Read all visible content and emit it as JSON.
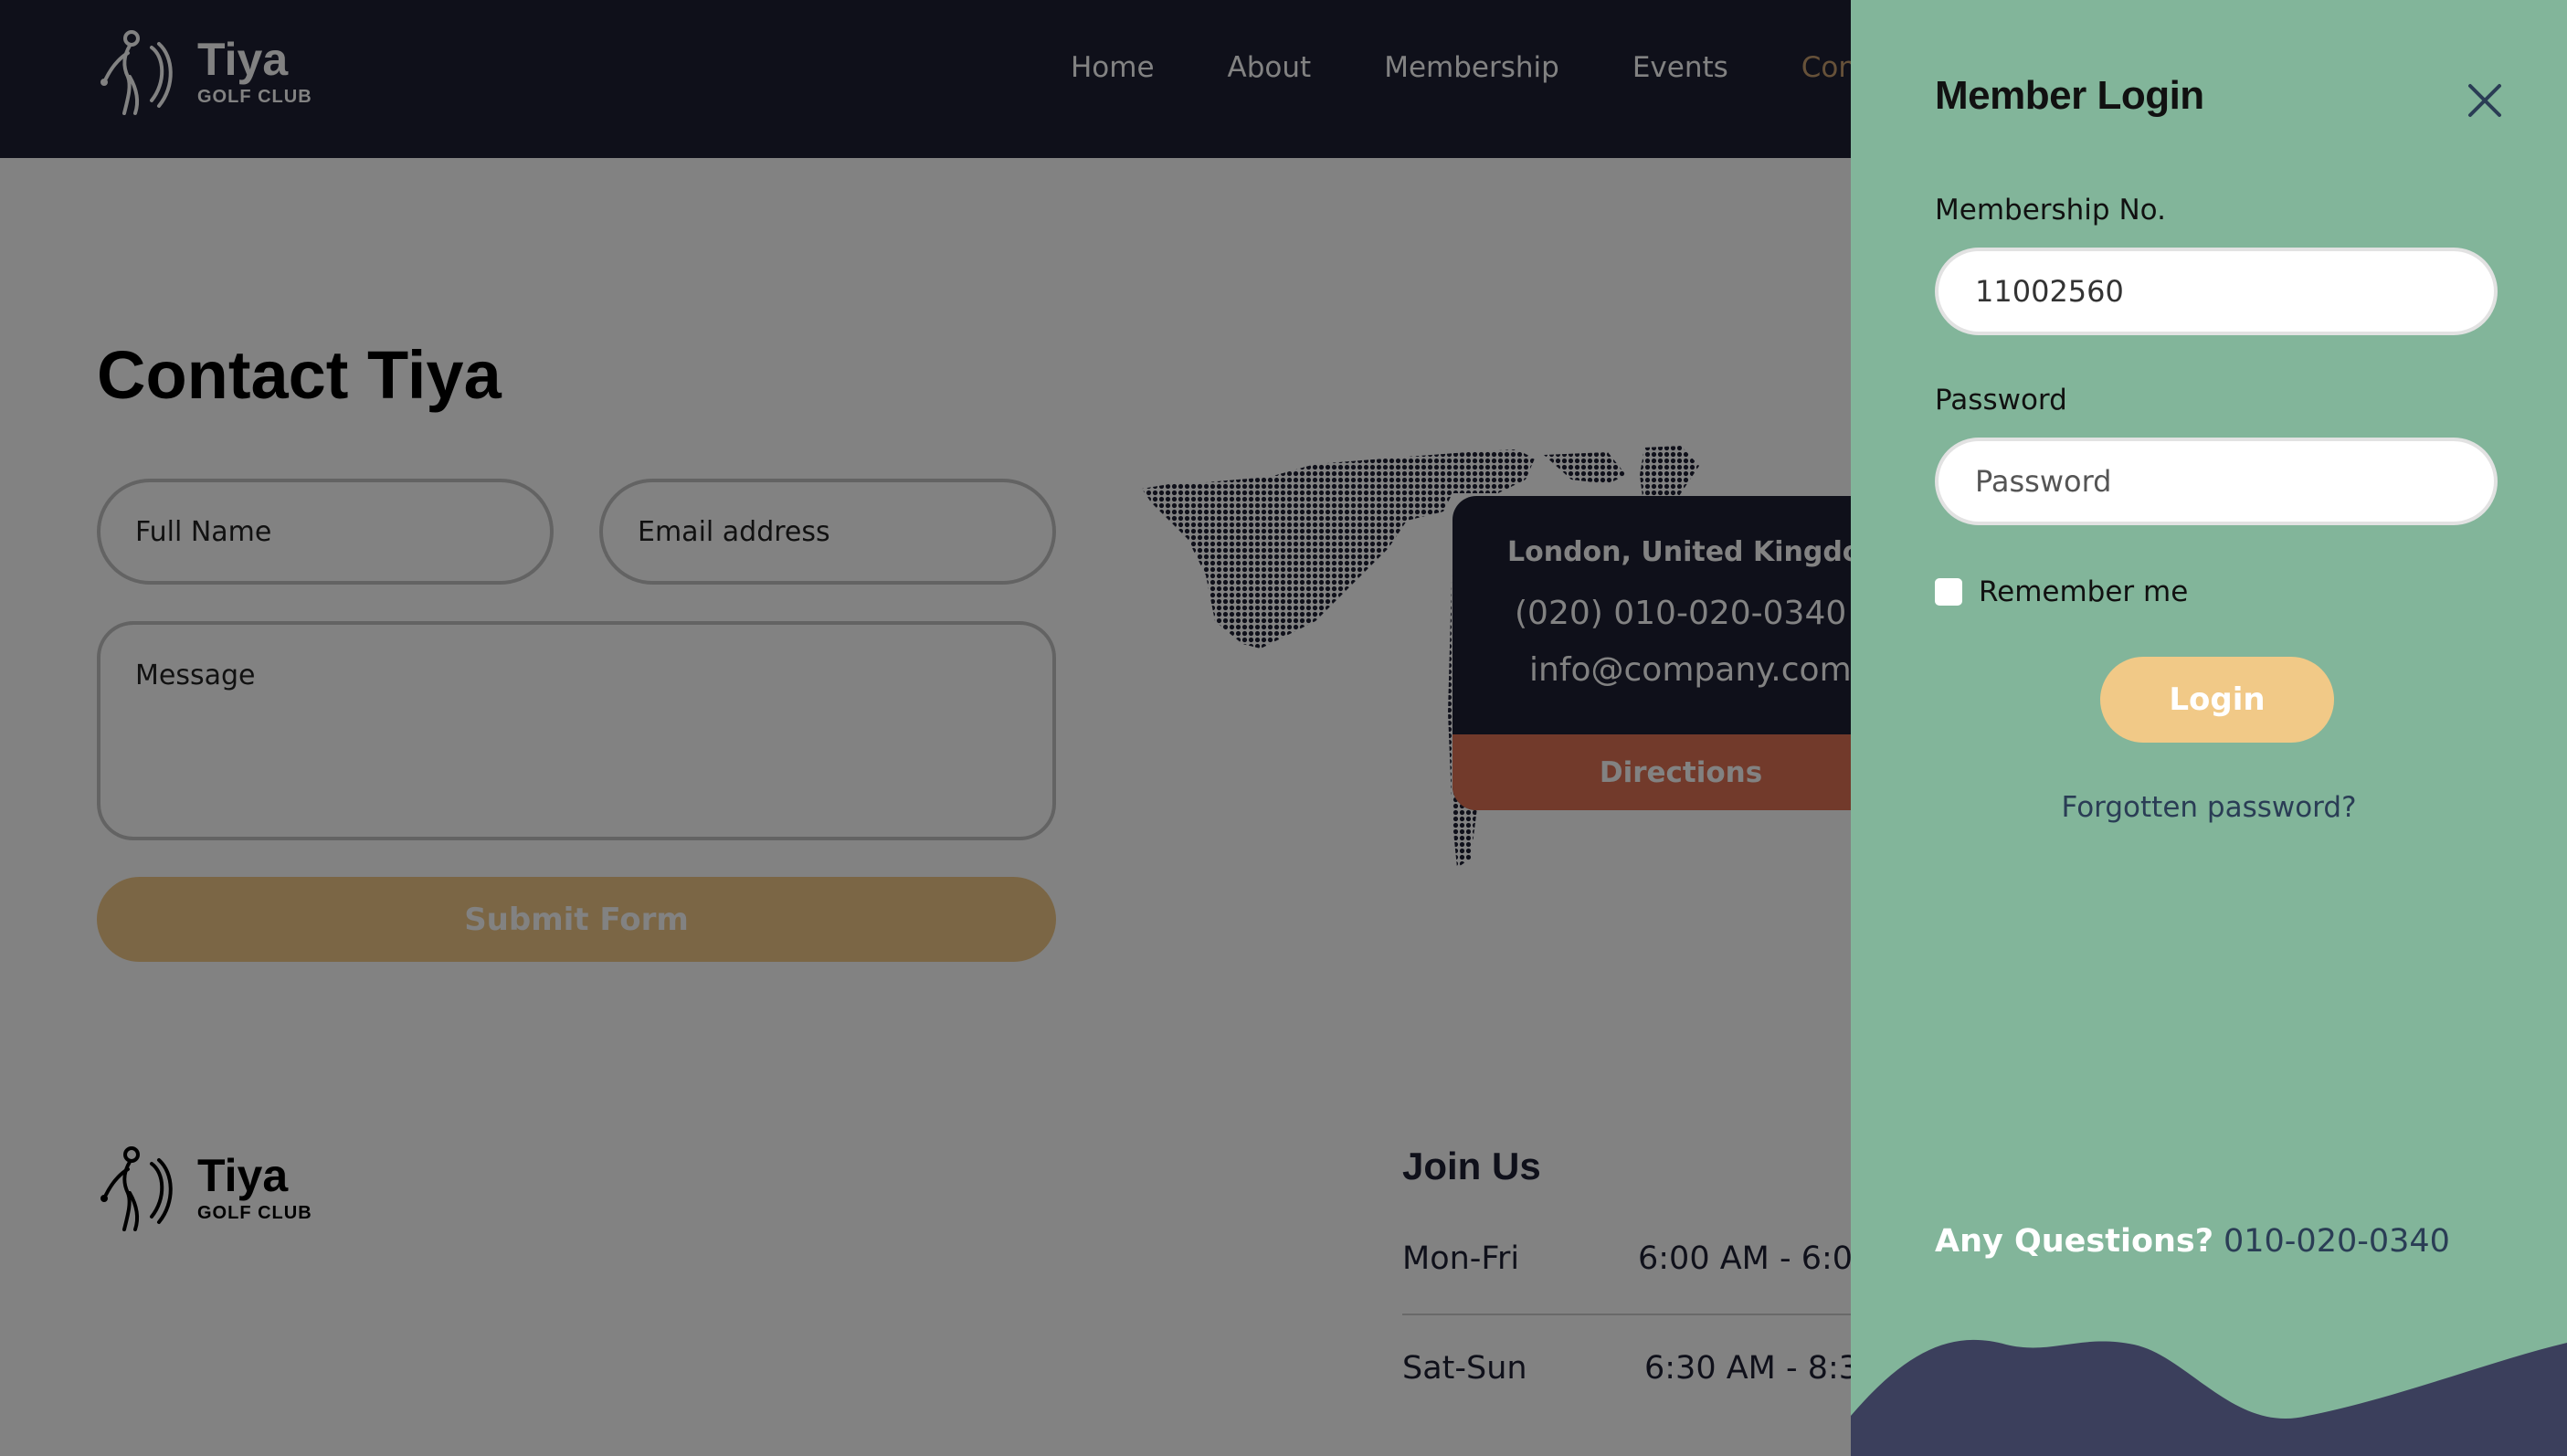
{
  "header": {
    "logo": {
      "title": "Tiya",
      "subtitle": "GOLF CLUB"
    },
    "nav": [
      {
        "label": "Home"
      },
      {
        "label": "About"
      },
      {
        "label": "Membership"
      },
      {
        "label": "Events"
      },
      {
        "label": "Con"
      }
    ]
  },
  "contact": {
    "title": "Contact Tiya",
    "full_name_placeholder": "Full Name",
    "email_placeholder": "Email address",
    "message_placeholder": "Message",
    "submit_label": "Submit Form"
  },
  "location": {
    "city": "London, United Kingdom",
    "phone": "(020) 010-020-0340",
    "email": "info@company.com",
    "directions_label": "Directions"
  },
  "footer": {
    "logo": {
      "title": "Tiya",
      "subtitle": "GOLF CLUB"
    },
    "join_title": "Join Us",
    "hours": [
      {
        "day": "Mon-Fri",
        "time": "6:00 AM - 6:0"
      },
      {
        "day": "Sat-Sun",
        "time": "6:30 AM - 8:3"
      }
    ]
  },
  "login_panel": {
    "title": "Member Login",
    "membership_label": "Membership No.",
    "membership_value": "11002560",
    "password_label": "Password",
    "password_placeholder": "Password",
    "remember_label": "Remember me",
    "login_label": "Login",
    "forgot_label": "Forgotten password?",
    "questions_label": "Any Questions?",
    "questions_phone": "010-020-0340"
  },
  "colors": {
    "navy": "#1e2033",
    "gold": "#f1c987",
    "panel_green": "#82b59a",
    "directions_red": "#e07255",
    "wave": "#3b3f5c"
  }
}
